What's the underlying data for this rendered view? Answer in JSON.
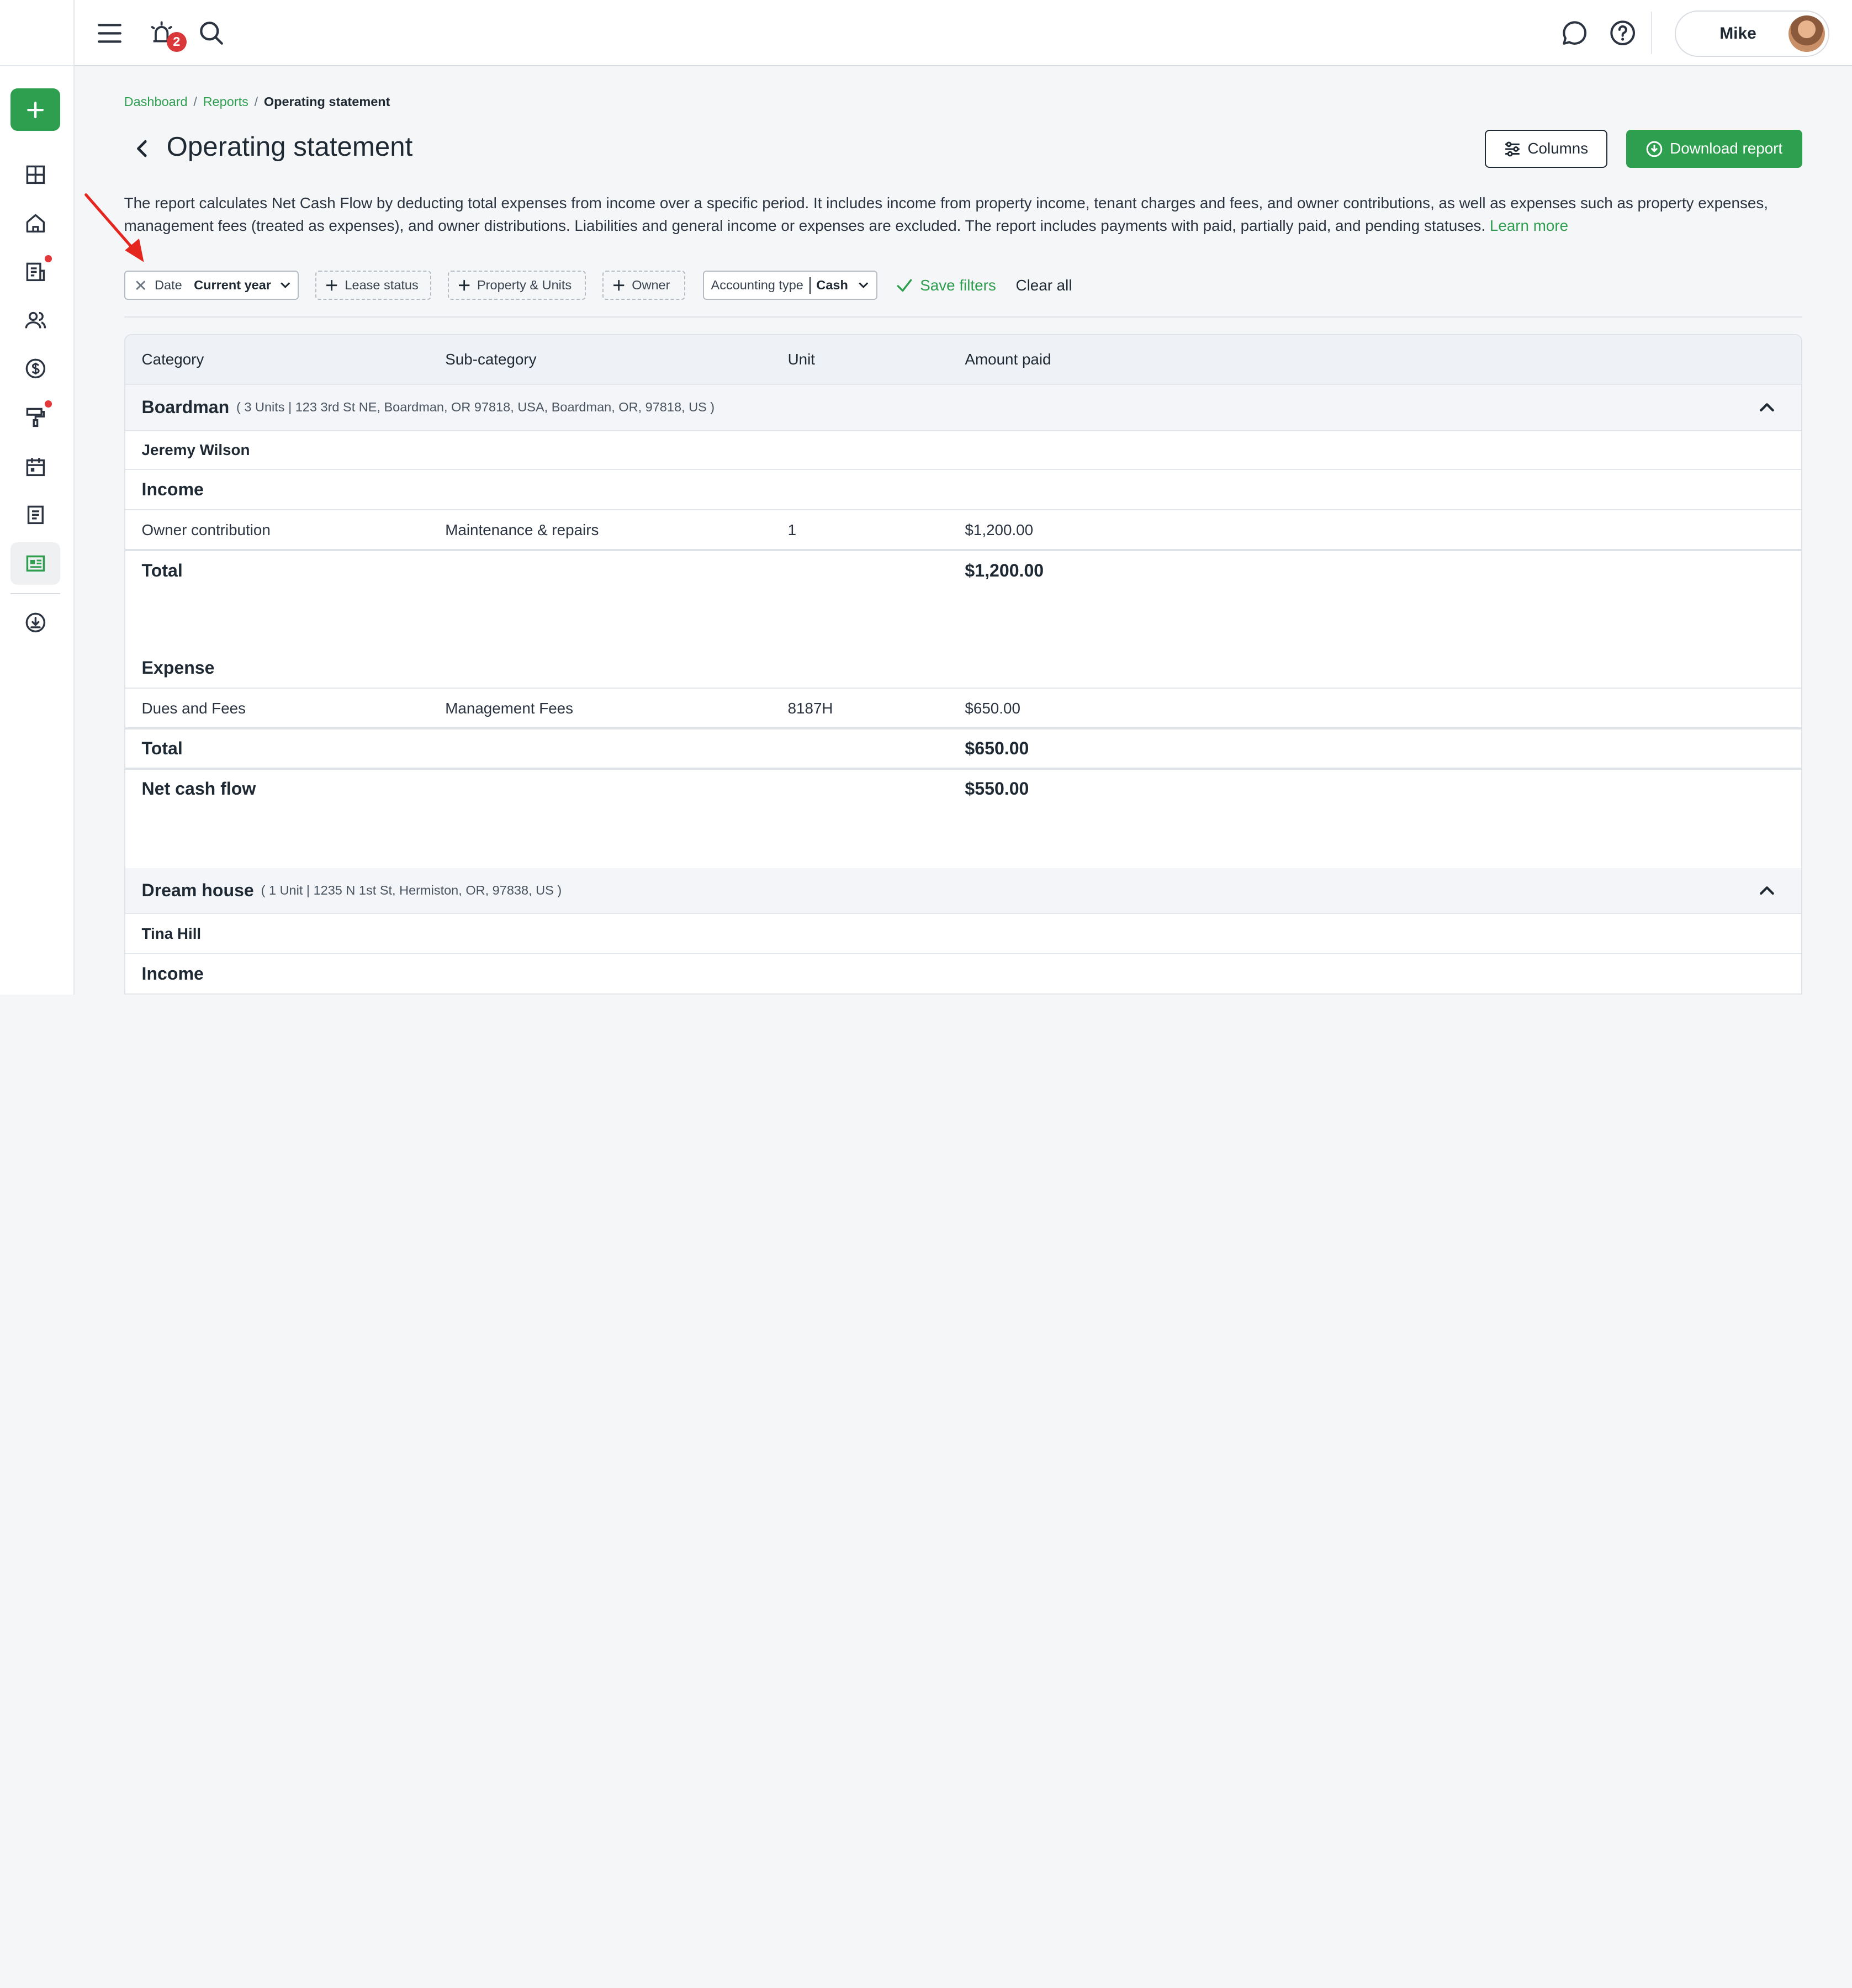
{
  "topbar": {
    "notifications_count": "2",
    "user_name": "Mike"
  },
  "breadcrumb": {
    "dashboard": "Dashboard",
    "reports": "Reports",
    "current": "Operating statement",
    "sep": "/"
  },
  "page": {
    "title": "Operating statement",
    "columns_label": "Columns",
    "download_label": "Download report",
    "description": "The report calculates Net Cash Flow by deducting total expenses from income over a specific period. It includes income from property income, tenant charges and fees, and owner contributions, as well as expenses such as property expenses, management fees (treated as expenses), and owner distributions. Liabilities and general income or expenses are excluded. The report includes payments with paid, partially paid, and pending statuses.",
    "learn_more": "Learn more"
  },
  "filters": {
    "date_label": "Date",
    "date_value": "Current year",
    "lease_status": "Lease status",
    "property_units": "Property & Units",
    "owner": "Owner",
    "accounting_label": "Accounting type",
    "accounting_value": "Cash",
    "save_filters": "Save filters",
    "clear_all": "Clear all"
  },
  "table": {
    "headers": [
      "Category",
      "Sub-category",
      "Unit",
      "Amount paid"
    ],
    "groups": [
      {
        "name": "Boardman",
        "meta": "( 3 Units | 123 3rd St NE, Boardman, OR 97818, USA, Boardman, OR, 97818, US )",
        "owner": "Jeremy Wilson",
        "income_label": "Income",
        "income_rows": [
          {
            "category": "Owner contribution",
            "subcategory": "Maintenance & repairs",
            "unit": "1",
            "amount": "$1,200.00"
          }
        ],
        "income_total_label": "Total",
        "income_total": "$1,200.00",
        "expense_label": "Expense",
        "expense_rows": [
          {
            "category": "Dues and Fees",
            "subcategory": "Management Fees",
            "unit": "8187H",
            "amount": "$650.00"
          }
        ],
        "expense_total_label": "Total",
        "expense_total": "$650.00",
        "net_label": "Net cash flow",
        "net_value": "$550.00"
      },
      {
        "name": "Dream house",
        "meta": "( 1 Unit | 1235 N 1st St, Hermiston, OR, 97838, US )",
        "owner": "Tina Hill",
        "income_label": "Income"
      }
    ]
  },
  "colors": {
    "brand_green": "#2e9e4f",
    "badge_red": "#d9373a"
  }
}
